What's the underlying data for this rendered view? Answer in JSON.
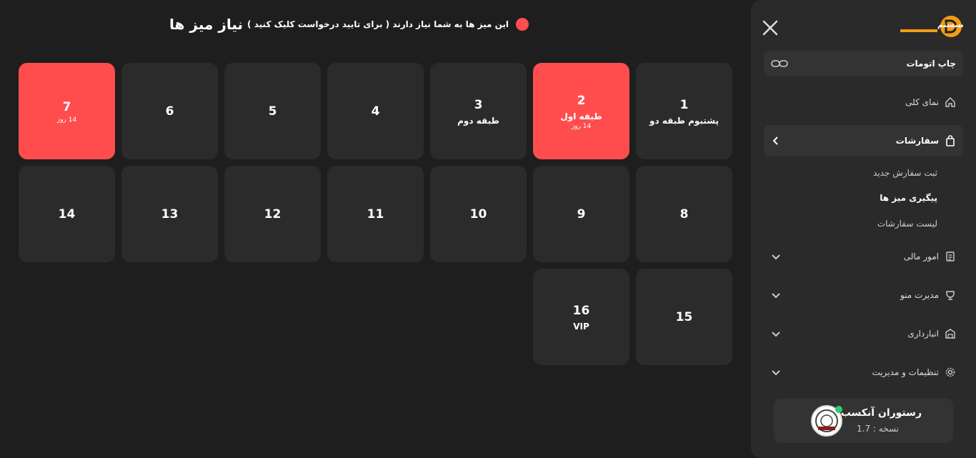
{
  "header": {
    "title": "نیاز میز ها",
    "subtitle": "این میز ها به شما نیاز دارند ( برای تایید درخواست کلیک کنید )"
  },
  "tiles": [
    {
      "number": "1",
      "label": "پشتبوم طبقه دو",
      "days": "",
      "status": "normal"
    },
    {
      "number": "2",
      "label": "طبقه اول",
      "days": "14 روز",
      "status": "alert"
    },
    {
      "number": "3",
      "label": "طبقه دوم",
      "days": "",
      "status": "normal"
    },
    {
      "number": "4",
      "label": "",
      "days": "",
      "status": "normal"
    },
    {
      "number": "5",
      "label": "",
      "days": "",
      "status": "normal"
    },
    {
      "number": "6",
      "label": "",
      "days": "",
      "status": "normal"
    },
    {
      "number": "7",
      "label": "",
      "days": "14 روز",
      "status": "alert"
    },
    {
      "number": "8",
      "label": "",
      "days": "",
      "status": "normal"
    },
    {
      "number": "9",
      "label": "",
      "days": "",
      "status": "normal"
    },
    {
      "number": "10",
      "label": "",
      "days": "",
      "status": "normal"
    },
    {
      "number": "11",
      "label": "",
      "days": "",
      "status": "normal"
    },
    {
      "number": "12",
      "label": "",
      "days": "",
      "status": "normal"
    },
    {
      "number": "13",
      "label": "",
      "days": "",
      "status": "normal"
    },
    {
      "number": "14",
      "label": "",
      "days": "",
      "status": "normal"
    },
    {
      "number": "15",
      "label": "",
      "days": "",
      "status": "normal"
    },
    {
      "number": "16",
      "label": "VIP",
      "days": "",
      "status": "normal"
    }
  ],
  "sidebar": {
    "logo_text": "رستوسیستم",
    "print_label": "چاپ اتومات",
    "nav": {
      "overview": "نمای کلی",
      "orders": "سفارشات",
      "finance": "امور مالی",
      "menu": "مدیرت منو",
      "inventory": "انبارداری",
      "settings": "تنظیمات و مدیریت"
    },
    "orders_sub": [
      "ثبت سفارش جدید",
      "پیگیری میز ها",
      "لیست سفارشات"
    ]
  },
  "profile": {
    "name": "رستوران آنکسب",
    "version": "نسخه : 1.7"
  },
  "colors": {
    "background": "#1e1e1e",
    "tile": "#2b2b2b",
    "alert": "#ff4d4d",
    "sidebar": "#2a2a2a",
    "logo_accent": "#f39c12",
    "online": "#2ecc71"
  }
}
